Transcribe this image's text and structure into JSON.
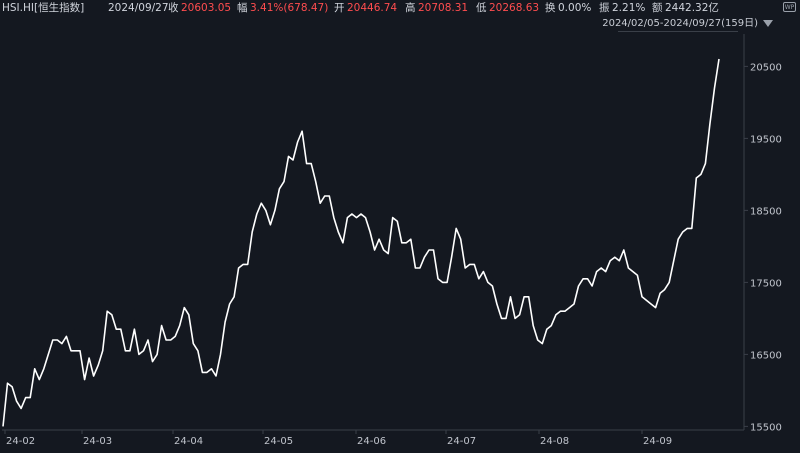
{
  "header": {
    "symbol": "HSI.HI[恒生指数]",
    "date": "2024/09/27",
    "close_label": "收",
    "close_value": "20603.05",
    "change_label": "幅",
    "change_value": "3.41%(678.47)",
    "open_label": "开",
    "open_value": "20446.74",
    "high_label": "高",
    "high_value": "20708.31",
    "low_label": "低",
    "low_value": "20268.63",
    "turnover_label": "换",
    "turnover_value": "0.00%",
    "amplitude_label": "振",
    "amplitude_value": "2.21%",
    "amount_label": "额",
    "amount_value": "2442.32亿",
    "range_text": "2024/02/05-2024/09/27(159日)",
    "wp_icon_label": "WP"
  },
  "colors": {
    "background": "#141820",
    "line": "#ffffff",
    "up": "#ff4d4f",
    "text": "#c8ccd4",
    "axis": "#3a3f48"
  },
  "chart_data": {
    "type": "line",
    "xlabel": "",
    "ylabel": "",
    "x_ticks": [
      "24-02",
      "24-03",
      "24-04",
      "24-05",
      "24-06",
      "24-07",
      "24-08",
      "24-09"
    ],
    "y_ticks": [
      15500,
      16500,
      17500,
      18500,
      19500,
      20500
    ],
    "ylim": [
      15450,
      20950
    ],
    "grid": false,
    "series": [
      {
        "values": [
          15500,
          16100,
          16050,
          15850,
          15750,
          15900,
          15900,
          16300,
          16150,
          16300,
          16500,
          16700,
          16700,
          16650,
          16750,
          16550,
          16550,
          16550,
          16150,
          16450,
          16200,
          16350,
          16550,
          17100,
          17050,
          16850,
          16850,
          16550,
          16550,
          16850,
          16500,
          16550,
          16700,
          16400,
          16500,
          16900,
          16700,
          16700,
          16750,
          16900,
          17150,
          17050,
          16650,
          16550,
          16250,
          16250,
          16300,
          16200,
          16500,
          16950,
          17200,
          17300,
          17700,
          17750,
          17750,
          18200,
          18450,
          18600,
          18500,
          18300,
          18500,
          18800,
          18900,
          19250,
          19200,
          19450,
          19600,
          19150,
          19150,
          18900,
          18600,
          18700,
          18700,
          18400,
          18200,
          18050,
          18400,
          18450,
          18400,
          18450,
          18400,
          18200,
          17950,
          18100,
          17950,
          17900,
          18400,
          18350,
          18050,
          18050,
          18100,
          17700,
          17700,
          17850,
          17950,
          17950,
          17550,
          17500,
          17500,
          17850,
          18250,
          18100,
          17700,
          17750,
          17750,
          17550,
          17650,
          17500,
          17450,
          17200,
          17000,
          17000,
          17300,
          17000,
          17050,
          17300,
          17300,
          16900,
          16700,
          16650,
          16850,
          16900,
          17050,
          17100,
          17100,
          17150,
          17200,
          17450,
          17550,
          17550,
          17450,
          17650,
          17700,
          17650,
          17800,
          17850,
          17800,
          17950,
          17700,
          17650,
          17600,
          17300,
          17250,
          17200,
          17150,
          17350,
          17400,
          17500,
          17800,
          18100,
          18200,
          18250,
          18250,
          18950,
          19000,
          19150,
          19700,
          20200,
          20603
        ]
      }
    ]
  }
}
